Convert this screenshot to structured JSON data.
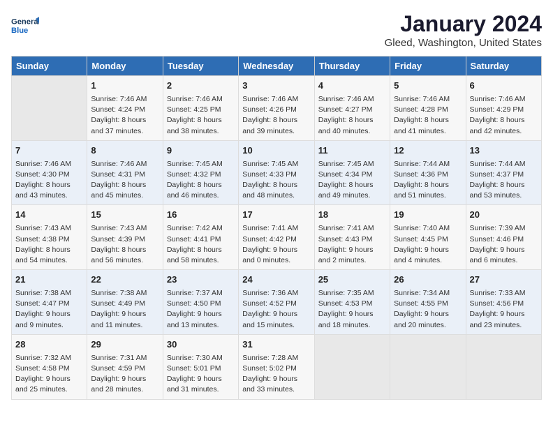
{
  "header": {
    "logo_line1": "General",
    "logo_line2": "Blue",
    "title": "January 2024",
    "subtitle": "Gleed, Washington, United States"
  },
  "days_of_week": [
    "Sunday",
    "Monday",
    "Tuesday",
    "Wednesday",
    "Thursday",
    "Friday",
    "Saturday"
  ],
  "weeks": [
    [
      {
        "num": "",
        "info": ""
      },
      {
        "num": "1",
        "info": "Sunrise: 7:46 AM\nSunset: 4:24 PM\nDaylight: 8 hours\nand 37 minutes."
      },
      {
        "num": "2",
        "info": "Sunrise: 7:46 AM\nSunset: 4:25 PM\nDaylight: 8 hours\nand 38 minutes."
      },
      {
        "num": "3",
        "info": "Sunrise: 7:46 AM\nSunset: 4:26 PM\nDaylight: 8 hours\nand 39 minutes."
      },
      {
        "num": "4",
        "info": "Sunrise: 7:46 AM\nSunset: 4:27 PM\nDaylight: 8 hours\nand 40 minutes."
      },
      {
        "num": "5",
        "info": "Sunrise: 7:46 AM\nSunset: 4:28 PM\nDaylight: 8 hours\nand 41 minutes."
      },
      {
        "num": "6",
        "info": "Sunrise: 7:46 AM\nSunset: 4:29 PM\nDaylight: 8 hours\nand 42 minutes."
      }
    ],
    [
      {
        "num": "7",
        "info": "Sunrise: 7:46 AM\nSunset: 4:30 PM\nDaylight: 8 hours\nand 43 minutes."
      },
      {
        "num": "8",
        "info": "Sunrise: 7:46 AM\nSunset: 4:31 PM\nDaylight: 8 hours\nand 45 minutes."
      },
      {
        "num": "9",
        "info": "Sunrise: 7:45 AM\nSunset: 4:32 PM\nDaylight: 8 hours\nand 46 minutes."
      },
      {
        "num": "10",
        "info": "Sunrise: 7:45 AM\nSunset: 4:33 PM\nDaylight: 8 hours\nand 48 minutes."
      },
      {
        "num": "11",
        "info": "Sunrise: 7:45 AM\nSunset: 4:34 PM\nDaylight: 8 hours\nand 49 minutes."
      },
      {
        "num": "12",
        "info": "Sunrise: 7:44 AM\nSunset: 4:36 PM\nDaylight: 8 hours\nand 51 minutes."
      },
      {
        "num": "13",
        "info": "Sunrise: 7:44 AM\nSunset: 4:37 PM\nDaylight: 8 hours\nand 53 minutes."
      }
    ],
    [
      {
        "num": "14",
        "info": "Sunrise: 7:43 AM\nSunset: 4:38 PM\nDaylight: 8 hours\nand 54 minutes."
      },
      {
        "num": "15",
        "info": "Sunrise: 7:43 AM\nSunset: 4:39 PM\nDaylight: 8 hours\nand 56 minutes."
      },
      {
        "num": "16",
        "info": "Sunrise: 7:42 AM\nSunset: 4:41 PM\nDaylight: 8 hours\nand 58 minutes."
      },
      {
        "num": "17",
        "info": "Sunrise: 7:41 AM\nSunset: 4:42 PM\nDaylight: 9 hours\nand 0 minutes."
      },
      {
        "num": "18",
        "info": "Sunrise: 7:41 AM\nSunset: 4:43 PM\nDaylight: 9 hours\nand 2 minutes."
      },
      {
        "num": "19",
        "info": "Sunrise: 7:40 AM\nSunset: 4:45 PM\nDaylight: 9 hours\nand 4 minutes."
      },
      {
        "num": "20",
        "info": "Sunrise: 7:39 AM\nSunset: 4:46 PM\nDaylight: 9 hours\nand 6 minutes."
      }
    ],
    [
      {
        "num": "21",
        "info": "Sunrise: 7:38 AM\nSunset: 4:47 PM\nDaylight: 9 hours\nand 9 minutes."
      },
      {
        "num": "22",
        "info": "Sunrise: 7:38 AM\nSunset: 4:49 PM\nDaylight: 9 hours\nand 11 minutes."
      },
      {
        "num": "23",
        "info": "Sunrise: 7:37 AM\nSunset: 4:50 PM\nDaylight: 9 hours\nand 13 minutes."
      },
      {
        "num": "24",
        "info": "Sunrise: 7:36 AM\nSunset: 4:52 PM\nDaylight: 9 hours\nand 15 minutes."
      },
      {
        "num": "25",
        "info": "Sunrise: 7:35 AM\nSunset: 4:53 PM\nDaylight: 9 hours\nand 18 minutes."
      },
      {
        "num": "26",
        "info": "Sunrise: 7:34 AM\nSunset: 4:55 PM\nDaylight: 9 hours\nand 20 minutes."
      },
      {
        "num": "27",
        "info": "Sunrise: 7:33 AM\nSunset: 4:56 PM\nDaylight: 9 hours\nand 23 minutes."
      }
    ],
    [
      {
        "num": "28",
        "info": "Sunrise: 7:32 AM\nSunset: 4:58 PM\nDaylight: 9 hours\nand 25 minutes."
      },
      {
        "num": "29",
        "info": "Sunrise: 7:31 AM\nSunset: 4:59 PM\nDaylight: 9 hours\nand 28 minutes."
      },
      {
        "num": "30",
        "info": "Sunrise: 7:30 AM\nSunset: 5:01 PM\nDaylight: 9 hours\nand 31 minutes."
      },
      {
        "num": "31",
        "info": "Sunrise: 7:28 AM\nSunset: 5:02 PM\nDaylight: 9 hours\nand 33 minutes."
      },
      {
        "num": "",
        "info": ""
      },
      {
        "num": "",
        "info": ""
      },
      {
        "num": "",
        "info": ""
      }
    ]
  ]
}
